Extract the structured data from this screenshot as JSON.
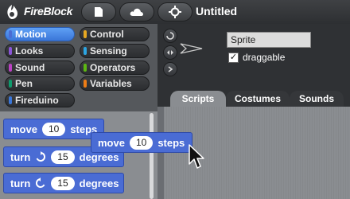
{
  "app": {
    "name": "FireBlock",
    "project_title": "Untitled"
  },
  "toolbar": {
    "buttons": [
      {
        "icon": "file-icon"
      },
      {
        "icon": "cloud-icon"
      },
      {
        "icon": "settings-icon"
      }
    ]
  },
  "categories": [
    {
      "label": "Motion",
      "color": "#4a6cd4",
      "selected": true
    },
    {
      "label": "Control",
      "color": "#e6a822"
    },
    {
      "label": "Looks",
      "color": "#8a55d7"
    },
    {
      "label": "Sensing",
      "color": "#2ca5e2"
    },
    {
      "label": "Sound",
      "color": "#bb42c3"
    },
    {
      "label": "Operators",
      "color": "#5cb712"
    },
    {
      "label": "Pen",
      "color": "#0e9a6c"
    },
    {
      "label": "Variables",
      "color": "#ee7d16"
    },
    {
      "label": "Fireduino",
      "color": "#3a76d8"
    }
  ],
  "palette_blocks": [
    {
      "prefix": "move",
      "value": "10",
      "suffix": "steps"
    },
    {
      "prefix": "turn",
      "icon": "rotate-clockwise-icon",
      "value": "15",
      "suffix": "degrees"
    },
    {
      "prefix": "turn",
      "icon": "rotate-counterclockwise-icon",
      "value": "15",
      "suffix": "degrees"
    }
  ],
  "dragged_block": {
    "prefix": "move",
    "value": "10",
    "suffix": "steps"
  },
  "sprite": {
    "name": "Sprite",
    "draggable_label": "draggable",
    "draggable_checked": "✓"
  },
  "tabs": [
    {
      "label": "Scripts",
      "active": true
    },
    {
      "label": "Costumes"
    },
    {
      "label": "Sounds"
    }
  ]
}
